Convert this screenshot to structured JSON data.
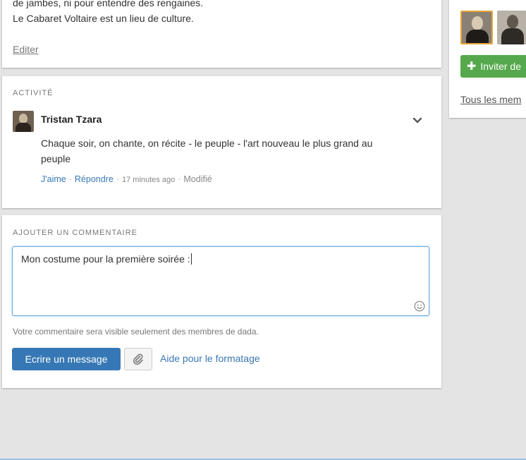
{
  "description": {
    "line1": "de jambes, ni pour entendre des rengaines.",
    "line2": "Le Cabaret Voltaire est un lieu de culture.",
    "edit_label": "Editer"
  },
  "activity": {
    "title": "ACTIVITÉ",
    "author": "Tristan Tzara",
    "text": "Chaque soir, on chante, on récite - le peuple - l'art nouveau le plus grand au peuple",
    "like_label": "J'aime",
    "reply_label": "Répondre",
    "time": "17 minutes ago",
    "modified_label": "Modifié",
    "separator": "·"
  },
  "comment": {
    "title": "AJOUTER UN COMMENTAIRE",
    "value": "Mon costume pour la première soirée :",
    "visibility_note": "Votre commentaire sera visible seulement des membres de dada.",
    "submit_label": "Ecrire un message",
    "format_help_label": "Aide pour le formatage"
  },
  "sidebar": {
    "invite_label": "Inviter de",
    "all_members_label": "Tous les mem"
  },
  "colors": {
    "primary": "#3678b5",
    "invite_green": "#56a84c",
    "selected_avatar_border": "#e6a43a"
  },
  "icons": [
    "chevron-down-icon",
    "smiley-icon",
    "paperclip-icon",
    "plus-icon"
  ]
}
